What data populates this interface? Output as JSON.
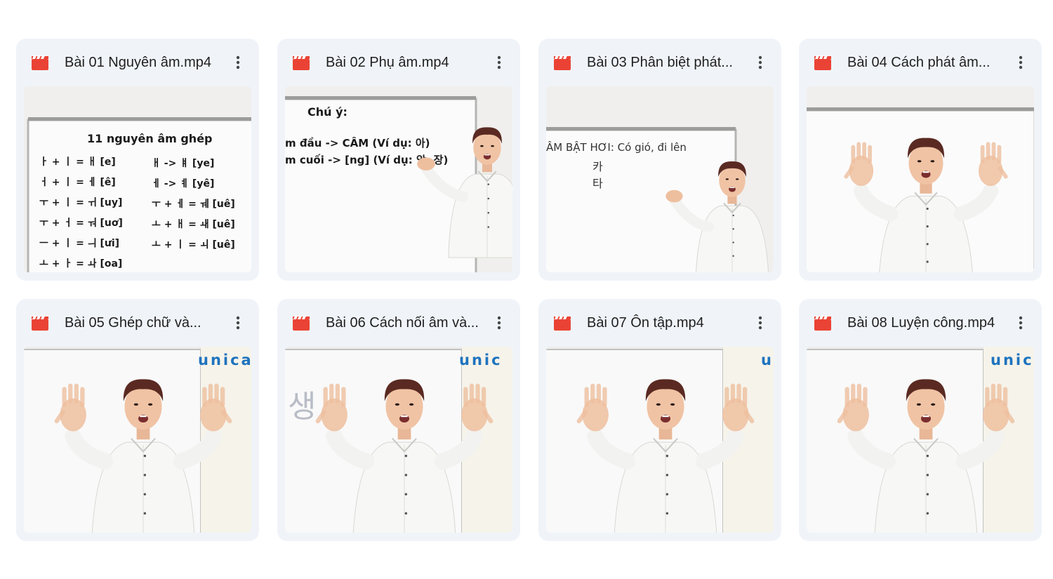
{
  "colors": {
    "card_bg": "#f0f4f9",
    "video_icon": "#ea4335",
    "brand_orange": "#f39c12",
    "brand_blue": "#1e73be"
  },
  "icons": {
    "file_type": "video-clapper-icon",
    "menu": "more-vert-icon"
  },
  "files": [
    {
      "name": "Bài 01 Nguyên âm.mp4",
      "thumbnail": {
        "heading": "11 nguyên âm ghép",
        "left_rows": [
          "ㅏ + ㅣ = ㅐ [e]",
          "ㅓ + ㅣ = ㅔ [ê]",
          "ㅜ + ㅣ = ㅟ [uy]",
          "ㅜ + ㅓ = ㅝ [uơ]",
          "ㅡ + ㅣ = ㅢ [ưi]",
          "ㅗ + ㅏ = ㅘ [oa]"
        ],
        "right_rows": [
          "ㅐ -> ㅒ [ye]",
          "ㅔ -> ㅖ [yê]",
          "ㅜ + ㅔ = ㅞ [uê]",
          "ㅗ + ㅐ = ㅙ [uê]",
          "ㅗ + ㅣ = ㅚ [uê]"
        ]
      }
    },
    {
      "name": "Bài 02 Phụ âm.mp4",
      "thumbnail": {
        "heading": "Chú ý:",
        "lines": [
          "m đầu -> CÂM (Ví dụ: 아)",
          "m cuối -> [ng] (Ví dụ: 앙, 장)"
        ]
      }
    },
    {
      "name": "Bài 03 Phân biệt phát...",
      "thumbnail": {
        "heading": "ÂM BẬT HƠI: Có gió, đi lên",
        "lines": [
          "카",
          "타"
        ]
      }
    },
    {
      "name": "Bài 04 Cách phát âm...",
      "thumbnail": {}
    },
    {
      "name": "Bài 05 Ghép chữ và...",
      "thumbnail": {
        "brand": "unica"
      }
    },
    {
      "name": "Bài 06 Cách nối âm và...",
      "thumbnail": {
        "brand": "unic",
        "hand_text": "생"
      }
    },
    {
      "name": "Bài 07 Ôn tập.mp4",
      "thumbnail": {
        "brand": "u"
      }
    },
    {
      "name": "Bài 08 Luyện công.mp4",
      "thumbnail": {
        "brand": "unicc"
      }
    }
  ]
}
